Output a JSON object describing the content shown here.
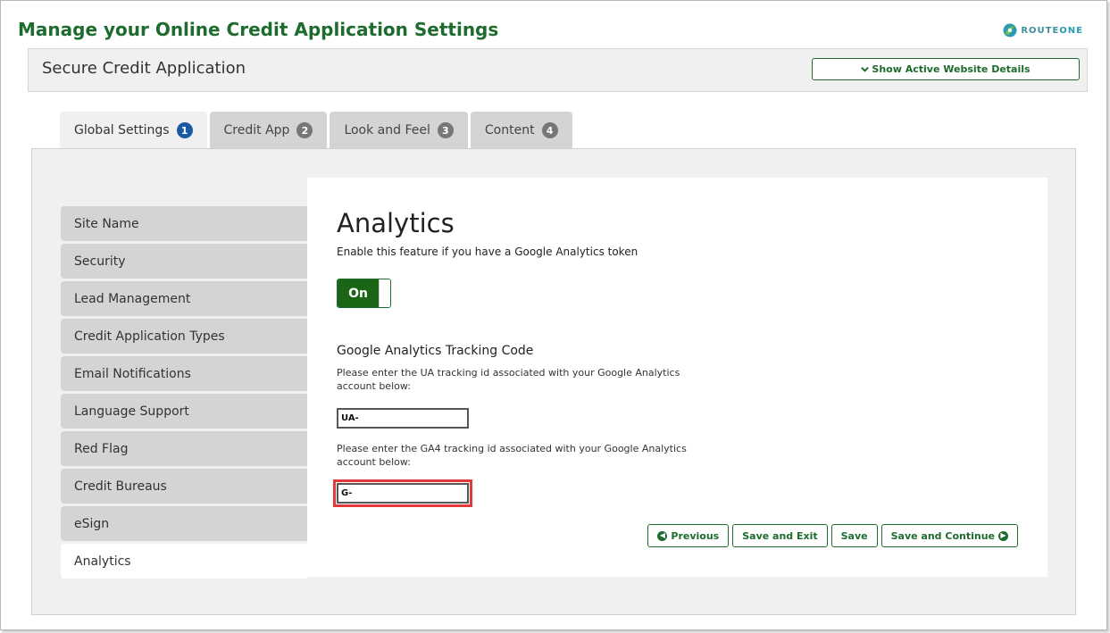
{
  "page": {
    "title": "Manage your Online Credit Application Settings",
    "logo": {
      "route": "ROUTE",
      "one": "ONE"
    }
  },
  "header": {
    "title": "Secure Credit Application",
    "details_button": "Show Active Website Details"
  },
  "tabs": [
    {
      "label": "Global Settings",
      "badge": "1",
      "active": true
    },
    {
      "label": "Credit App",
      "badge": "2"
    },
    {
      "label": "Look and Feel",
      "badge": "3"
    },
    {
      "label": "Content",
      "badge": "4"
    }
  ],
  "sidebar": {
    "items": [
      {
        "label": "Site Name"
      },
      {
        "label": "Security"
      },
      {
        "label": "Lead Management"
      },
      {
        "label": "Credit Application Types"
      },
      {
        "label": "Email Notifications"
      },
      {
        "label": "Language Support"
      },
      {
        "label": "Red Flag"
      },
      {
        "label": "Credit Bureaus"
      },
      {
        "label": "eSign"
      },
      {
        "label": "Analytics",
        "active": true
      }
    ]
  },
  "main": {
    "heading": "Analytics",
    "description": "Enable this feature if you have a Google Analytics token",
    "toggle_label": "On",
    "tracking_title": "Google Analytics Tracking Code",
    "ua_help": "Please enter the UA tracking id associated with your Google Analytics account below:",
    "ua_value": "UA-",
    "ga4_help": "Please enter the GA4 tracking id associated with your Google Analytics account below:",
    "ga4_value": "G-"
  },
  "buttons": {
    "previous": "Previous",
    "save_exit": "Save and Exit",
    "save": "Save",
    "save_continue": "Save and Continue"
  },
  "colors": {
    "brand_green": "#1e6b2e",
    "toggle_green": "#1b6516",
    "active_badge": "#1a5aa0",
    "highlight_red": "#e23a3a"
  }
}
